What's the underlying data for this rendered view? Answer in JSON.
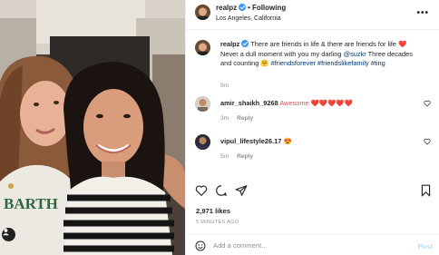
{
  "post": {
    "username": "realpz",
    "following_label": "Following",
    "location": "Los Angeles, California",
    "more_label": "•••"
  },
  "caption": {
    "username": "realpz",
    "text_part1": "There are friends in life & there are friends for life ❤️ Never a dull moment with you my darling ",
    "mention": "@suzkr",
    "text_part2": " Three decades and counting 🤗 ",
    "hashtags": "#friendsforever #friendslikefamily #ting",
    "time": "5m"
  },
  "comments": [
    {
      "username": "amir_shaikh_9268",
      "text": "Awesome ❤️❤️❤️❤️❤️",
      "time": "3m",
      "reply_label": "Reply"
    },
    {
      "username": "vipul_lifestyle26.17",
      "text": "😍",
      "time": "5m",
      "reply_label": "Reply"
    }
  ],
  "likes_text": "2,971 likes",
  "timestamp": "5 MINUTES AGO",
  "add_comment": {
    "placeholder": "Add a comment...",
    "post_label": "Post"
  },
  "icons": {
    "like": "heart-icon",
    "comment": "comment-icon",
    "share": "share-icon",
    "save": "bookmark-icon",
    "emoji": "emoji-icon",
    "user_tag": "user-tag-icon",
    "verified": "verified-badge-icon"
  },
  "colors": {
    "link": "#00376b",
    "verified": "#3897f0",
    "muted": "#8e8e8e",
    "post_disabled": "#b2dffc",
    "heart_red": "#ed4956"
  }
}
